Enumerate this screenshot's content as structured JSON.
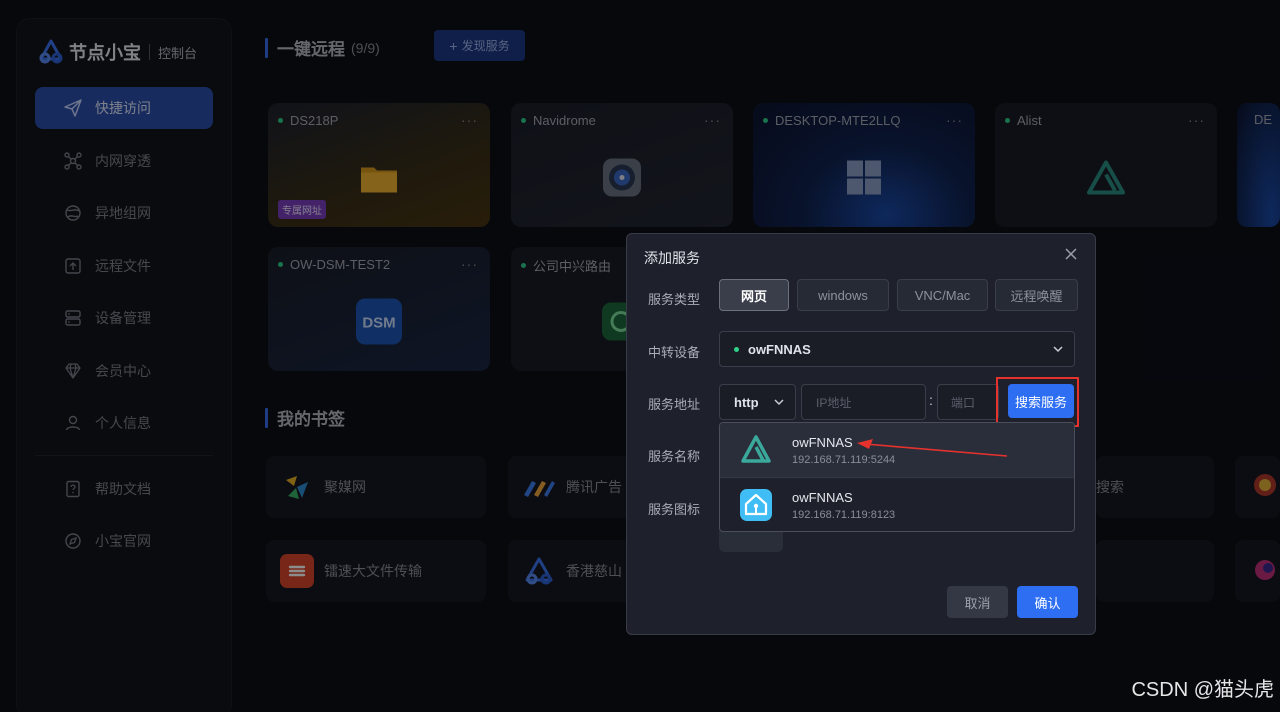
{
  "app": {
    "brand": "节点小宝",
    "subtitle": "控制台"
  },
  "sidebar": {
    "items": [
      {
        "label": "快捷访问",
        "icon": "send-icon",
        "active": true
      },
      {
        "label": "内网穿透",
        "icon": "network-icon"
      },
      {
        "label": "异地组网",
        "icon": "globe-icon"
      },
      {
        "label": "远程文件",
        "icon": "upload-file-icon"
      },
      {
        "label": "设备管理",
        "icon": "server-icon"
      },
      {
        "label": "会员中心",
        "icon": "diamond-icon"
      },
      {
        "label": "个人信息",
        "icon": "user-icon"
      },
      {
        "label": "帮助文档",
        "icon": "help-doc-icon"
      },
      {
        "label": "小宝官网",
        "icon": "compass-icon"
      }
    ]
  },
  "quick": {
    "title": "一键远程",
    "count": "(9/9)",
    "discover_label": "发现服务",
    "cards": [
      {
        "name": "DS218P",
        "tag": "专属网址"
      },
      {
        "name": "Navidrome"
      },
      {
        "name": "DESKTOP-MTE2LLQ"
      },
      {
        "name": "Alist"
      },
      {
        "name": "DE"
      },
      {
        "name": "OW-DSM-TEST2"
      },
      {
        "name": "公司中兴路由"
      }
    ],
    "more": "···"
  },
  "bookmarks": {
    "title": "我的书签",
    "items": [
      {
        "label": "聚媒网"
      },
      {
        "label": "腾讯广告"
      },
      {
        "label": "搜索"
      },
      {
        "label": "镭速大文件传输"
      },
      {
        "label": "香港慈山"
      }
    ]
  },
  "modal": {
    "title": "添加服务",
    "labels": {
      "type": "服务类型",
      "relay": "中转设备",
      "address": "服务地址",
      "name": "服务名称",
      "icon": "服务图标"
    },
    "types": [
      "网页",
      "windows",
      "VNC/Mac",
      "远程唤醒"
    ],
    "relay_value": "owFNNAS",
    "protocol": "http",
    "ip_placeholder": "IP地址",
    "port_placeholder": "端口",
    "colon": ":",
    "search_label": "搜索服务",
    "results": [
      {
        "name": "owFNNAS",
        "address": "192.168.71.119:5244"
      },
      {
        "name": "owFNNAS",
        "address": "192.168.71.119:8123"
      }
    ],
    "cancel_label": "取消",
    "confirm_label": "确认"
  },
  "watermark": "CSDN @猫头虎",
  "colors": {
    "accent": "#2e6ef2",
    "online": "#2fd18a",
    "highlight": "#e5322d"
  }
}
